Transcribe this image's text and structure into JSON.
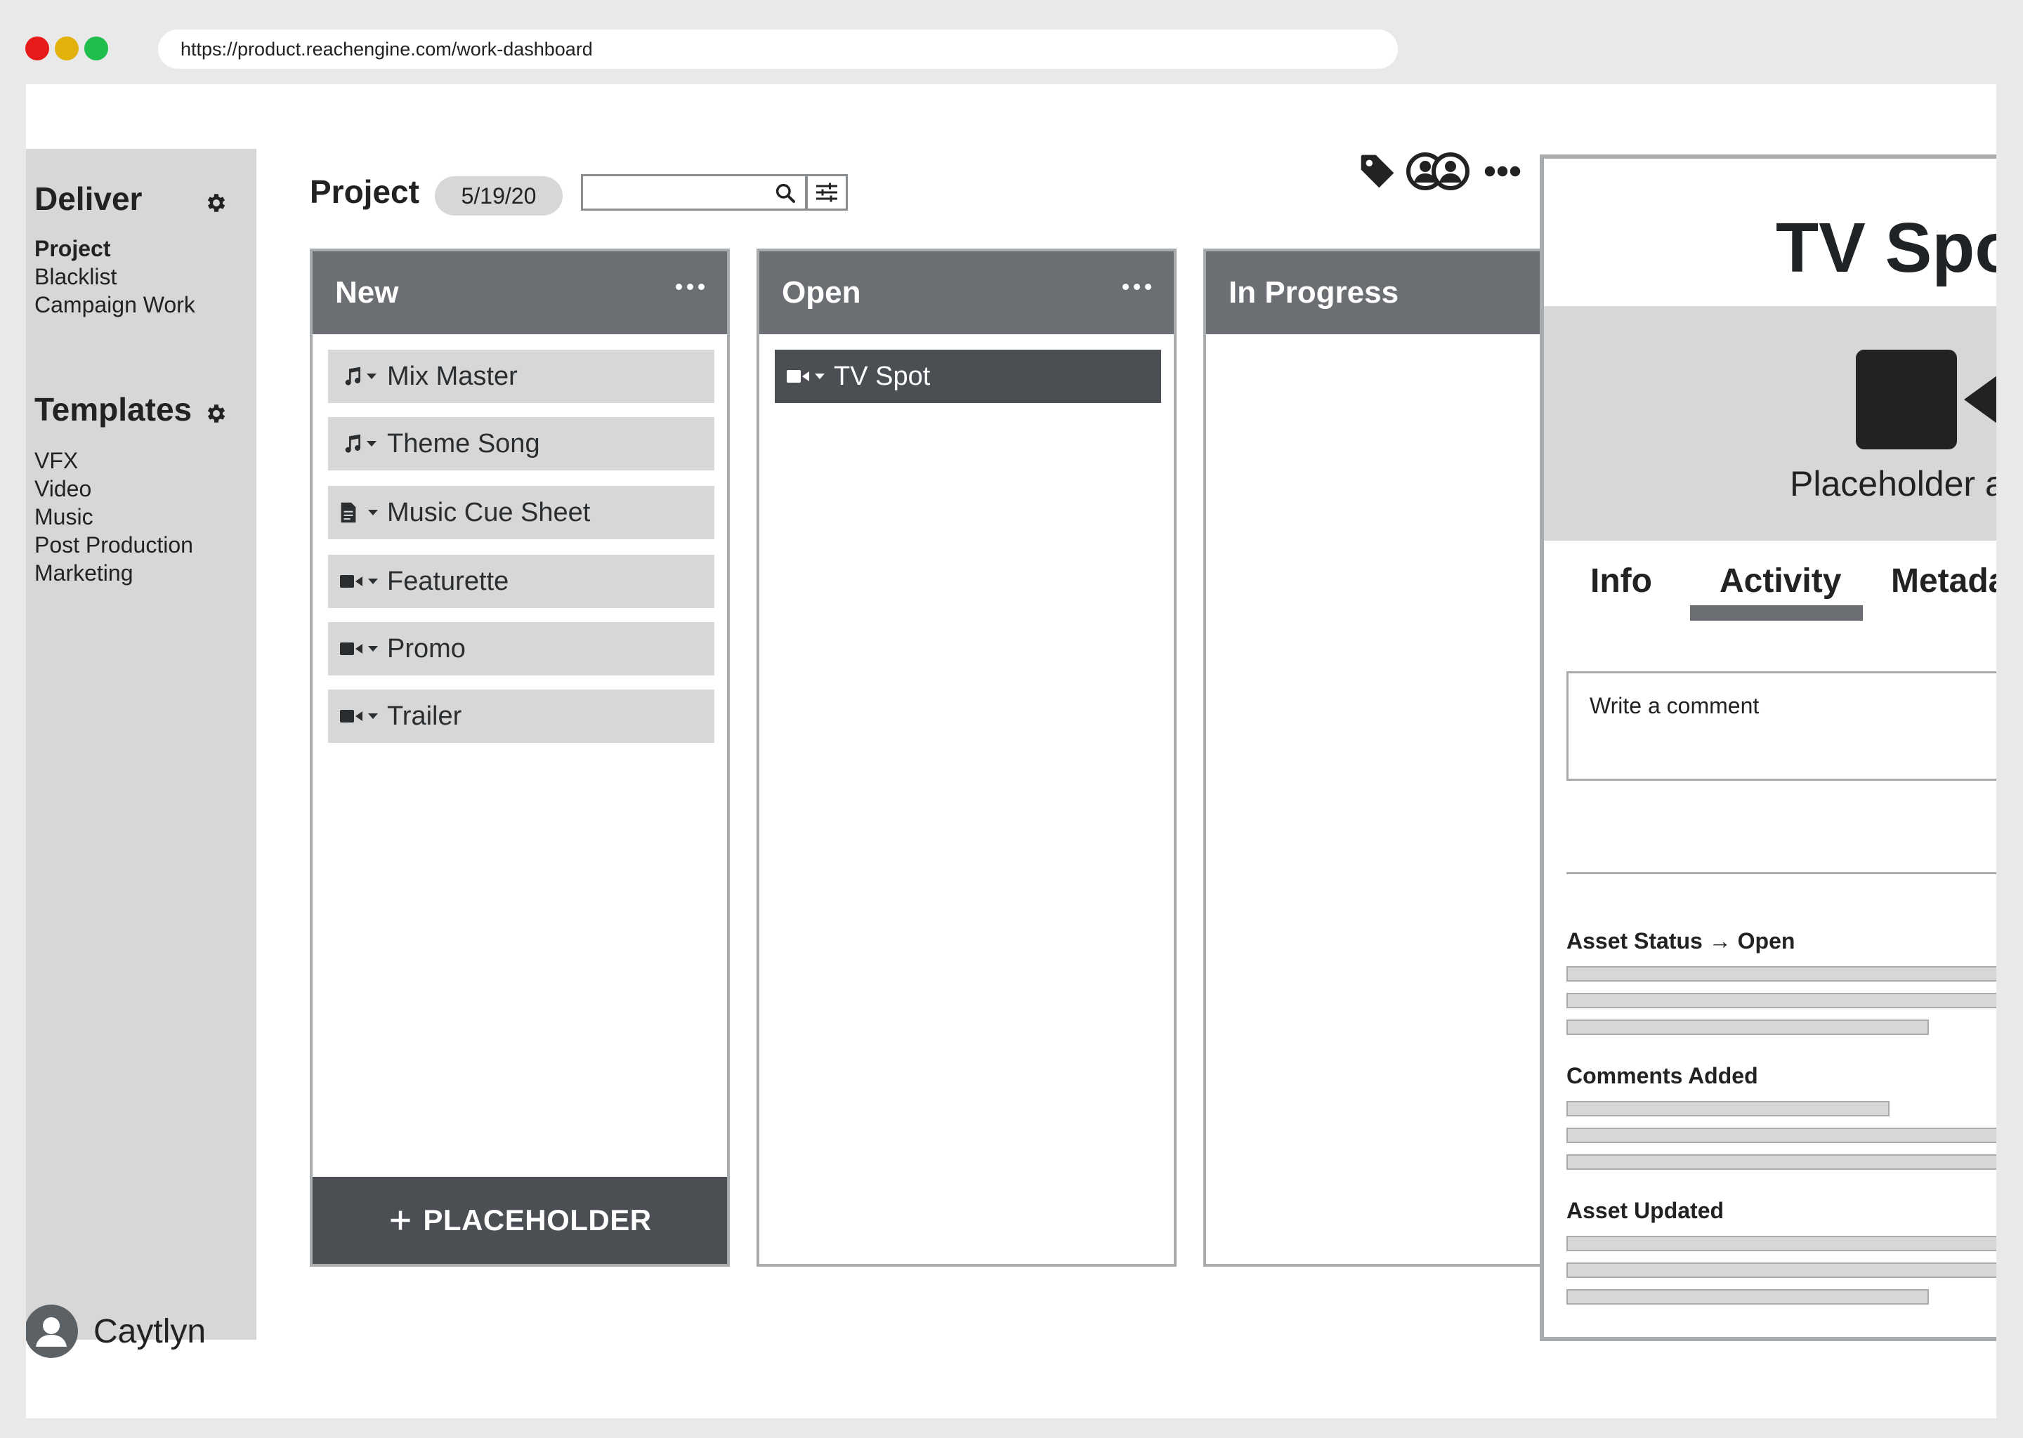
{
  "browser": {
    "url": "https://product.reachengine.com/work-dashboard",
    "traffic_lights": [
      "#e81a1a",
      "#e2b10c",
      "#1fbd4c"
    ]
  },
  "sidebar": {
    "deliver_heading": "Deliver",
    "deliver_items": [
      {
        "label": "Project",
        "active": true
      },
      {
        "label": "Blacklist"
      },
      {
        "label": "Campaign Work"
      }
    ],
    "templates_heading": "Templates",
    "template_items": [
      "VFX",
      "Video",
      "Music",
      "Post Production",
      "Marketing"
    ],
    "user_name": "Caytlyn"
  },
  "toolbar": {
    "title": "Project",
    "date": "5/19/20",
    "search_value": "",
    "icons": [
      "tag-icon",
      "users-icon",
      "more-icon"
    ]
  },
  "columns": [
    {
      "title": "New",
      "cards": [
        {
          "icon": "music-note-icon",
          "label": "Mix Master"
        },
        {
          "icon": "music-note-icon",
          "label": "Theme Song"
        },
        {
          "icon": "document-icon",
          "label": "Music Cue Sheet"
        },
        {
          "icon": "video-camera-icon",
          "label": "Featurette"
        },
        {
          "icon": "video-camera-icon",
          "label": "Promo"
        },
        {
          "icon": "video-camera-icon",
          "label": "Trailer"
        }
      ],
      "add_button": "PLACEHOLDER"
    },
    {
      "title": "Open",
      "cards": [
        {
          "icon": "video-camera-icon",
          "label": "TV Spot",
          "selected": true
        }
      ]
    },
    {
      "title": "In Progress",
      "cards": []
    }
  ],
  "detail": {
    "title": "TV Spot",
    "preview_caption": "Placeholder a",
    "tabs": [
      {
        "label": "Info"
      },
      {
        "label": "Activity",
        "active": true
      },
      {
        "label": "Metada"
      }
    ],
    "comment_placeholder": "Write a comment",
    "activity": [
      {
        "label": "Asset Status → Open"
      },
      {
        "label": "Comments Added"
      },
      {
        "label": "Asset Updated"
      }
    ]
  },
  "colors": {
    "header_gray": "#6b6f73",
    "dark_gray": "#4b4f53",
    "light_gray": "#d7d7d7",
    "border_gray": "#a9acae"
  }
}
